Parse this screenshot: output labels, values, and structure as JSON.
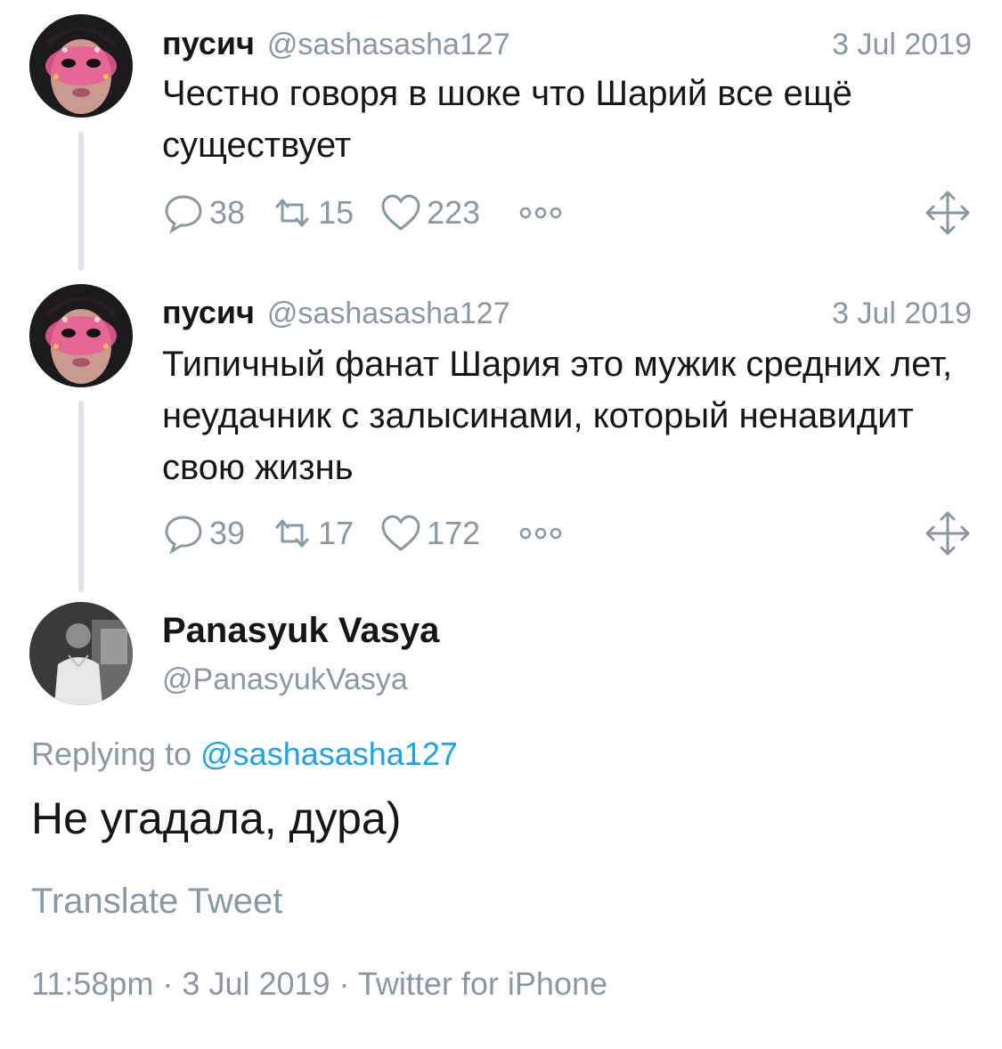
{
  "colors": {
    "accent": "#1da1f2",
    "muted": "#8899a6",
    "text": "#14171a",
    "thread": "#dde3e8"
  },
  "tweets": [
    {
      "name": "пусич",
      "handle": "@sashasasha127",
      "date": "3 Jul 2019",
      "text": "Честно говоря в шоке что Шарий все ещё существует",
      "replies": "38",
      "retweets": "15",
      "likes": "223"
    },
    {
      "name": "пусич",
      "handle": "@sashasasha127",
      "date": "3 Jul 2019",
      "text": "Типичный фанат Шария это мужик средних лет, неудачник с залысинами, который ненавидит свою жизнь",
      "replies": "39",
      "retweets": "17",
      "likes": "172"
    }
  ],
  "main": {
    "name": "Panasyuk Vasya",
    "handle": "@PanasyukVasya",
    "replying_prefix": "Replying to",
    "replying_to": "@sashasasha127",
    "text": "Не угадала, дура)",
    "translate": "Translate Tweet",
    "meta": "11:58pm · 3 Jul 2019 · Twitter for iPhone"
  },
  "icons": [
    "reply-icon",
    "retweet-icon",
    "like-icon",
    "more-icon",
    "share-icon"
  ]
}
